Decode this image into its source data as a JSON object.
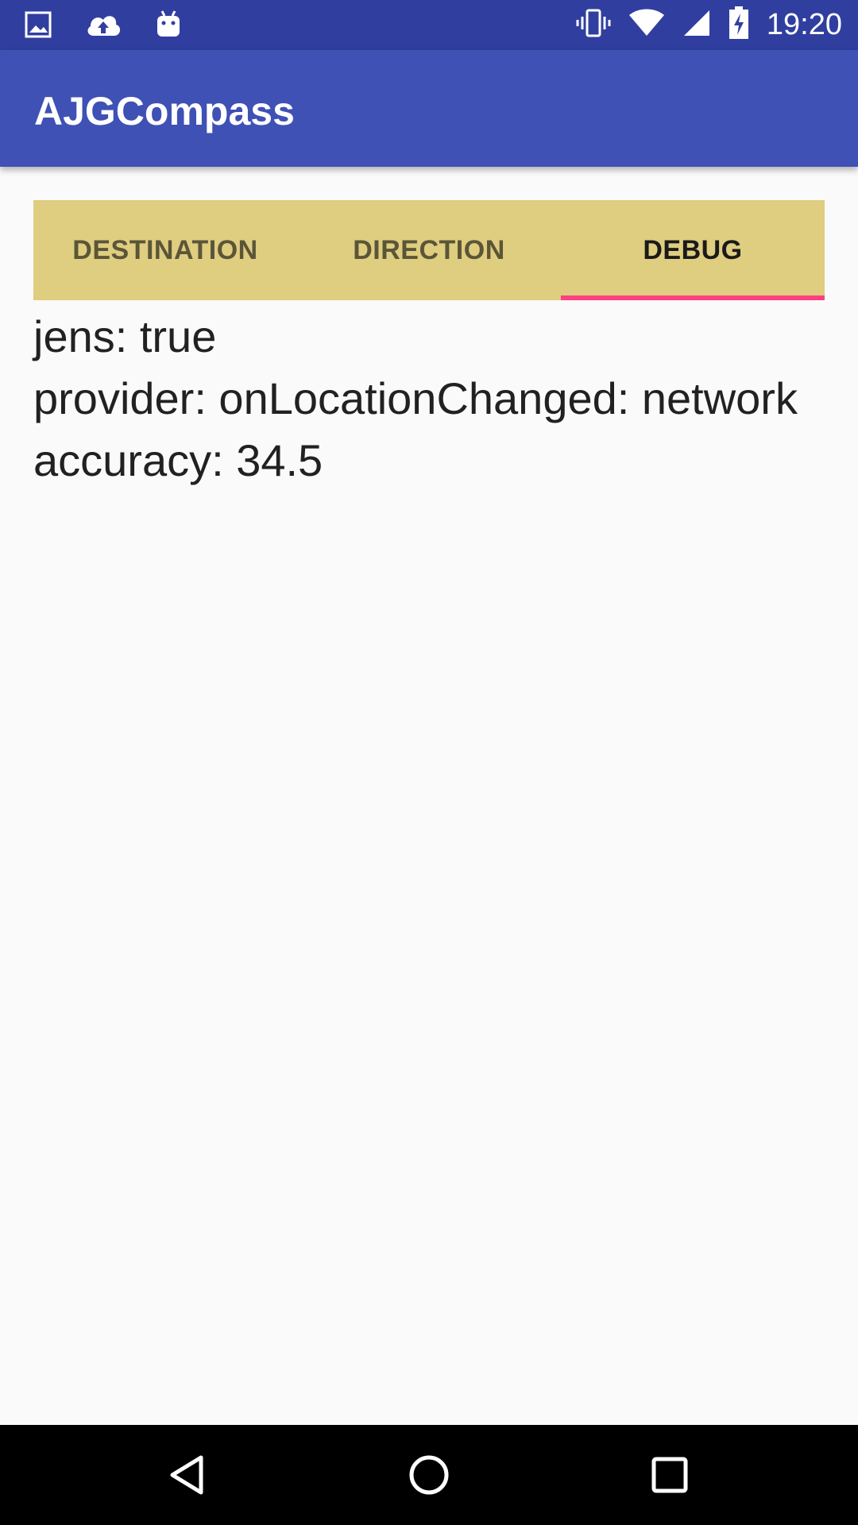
{
  "status_bar": {
    "time": "19:20",
    "left_icons": [
      "image-icon",
      "cloud-upload-icon",
      "android-icon"
    ],
    "right_icons": [
      "vibrate-icon",
      "wifi-icon",
      "cellular-signal-icon",
      "battery-charging-icon"
    ]
  },
  "app_bar": {
    "title": "AJGCompass",
    "color": "#3f51b5"
  },
  "tabs": [
    {
      "label": "DESTINATION",
      "active": false
    },
    {
      "label": "DIRECTION",
      "active": false
    },
    {
      "label": "DEBUG",
      "active": true
    }
  ],
  "tab_bar_color": "#dfcd80",
  "tab_indicator_color": "#ff4081",
  "debug": {
    "lines": [
      "jens: true",
      "provider: onLocationChanged: network",
      "accuracy: 34.5"
    ]
  },
  "nav_bar": {
    "buttons": [
      "back-icon",
      "home-icon",
      "recents-icon"
    ]
  }
}
